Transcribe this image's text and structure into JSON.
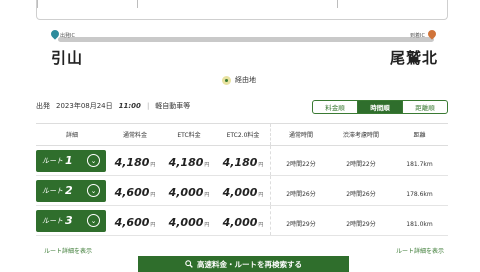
{
  "route": {
    "start_label": "出発IC",
    "end_label": "到着IC",
    "start_name": "引山",
    "end_name": "尾鷲北",
    "via_label": "経由地"
  },
  "info": {
    "direction": "出発",
    "date": "2023年08月24日",
    "time": "11:00",
    "vehicle": "軽自動車等"
  },
  "sort_tabs": [
    {
      "label": "料金順",
      "active": false
    },
    {
      "label": "時間順",
      "active": true
    },
    {
      "label": "距離順",
      "active": false
    }
  ],
  "table": {
    "headers": {
      "detail": "詳細",
      "normal_fee": "通常料金",
      "etc_fee": "ETC料金",
      "etc2_fee": "ETC2.0料金",
      "normal_time": "通常時間",
      "traffic_time": "渋滞考慮時間",
      "distance": "距離"
    },
    "route_prefix": "ルート",
    "yen": "円",
    "rows": [
      {
        "num": "1",
        "normal": "4,180",
        "etc": "4,180",
        "etc2": "4,180",
        "normal_time": "2時間22分",
        "traffic_time": "2時間22分",
        "distance": "181.7km"
      },
      {
        "num": "2",
        "normal": "4,600",
        "etc": "4,000",
        "etc2": "4,000",
        "normal_time": "2時間26分",
        "traffic_time": "2時間26分",
        "distance": "178.6km"
      },
      {
        "num": "3",
        "normal": "4,600",
        "etc": "4,000",
        "etc2": "4,000",
        "normal_time": "2時間29分",
        "traffic_time": "2時間29分",
        "distance": "181.0km"
      }
    ]
  },
  "partial_links": {
    "left": "ルート詳細を表示",
    "right": "ルート詳細を表示"
  },
  "search_button": "高速料金・ルートを再検索する",
  "colors": {
    "brand_green": "#2f6e2c",
    "start_pin": "#2d8b9c",
    "end_pin": "#d0743a"
  }
}
